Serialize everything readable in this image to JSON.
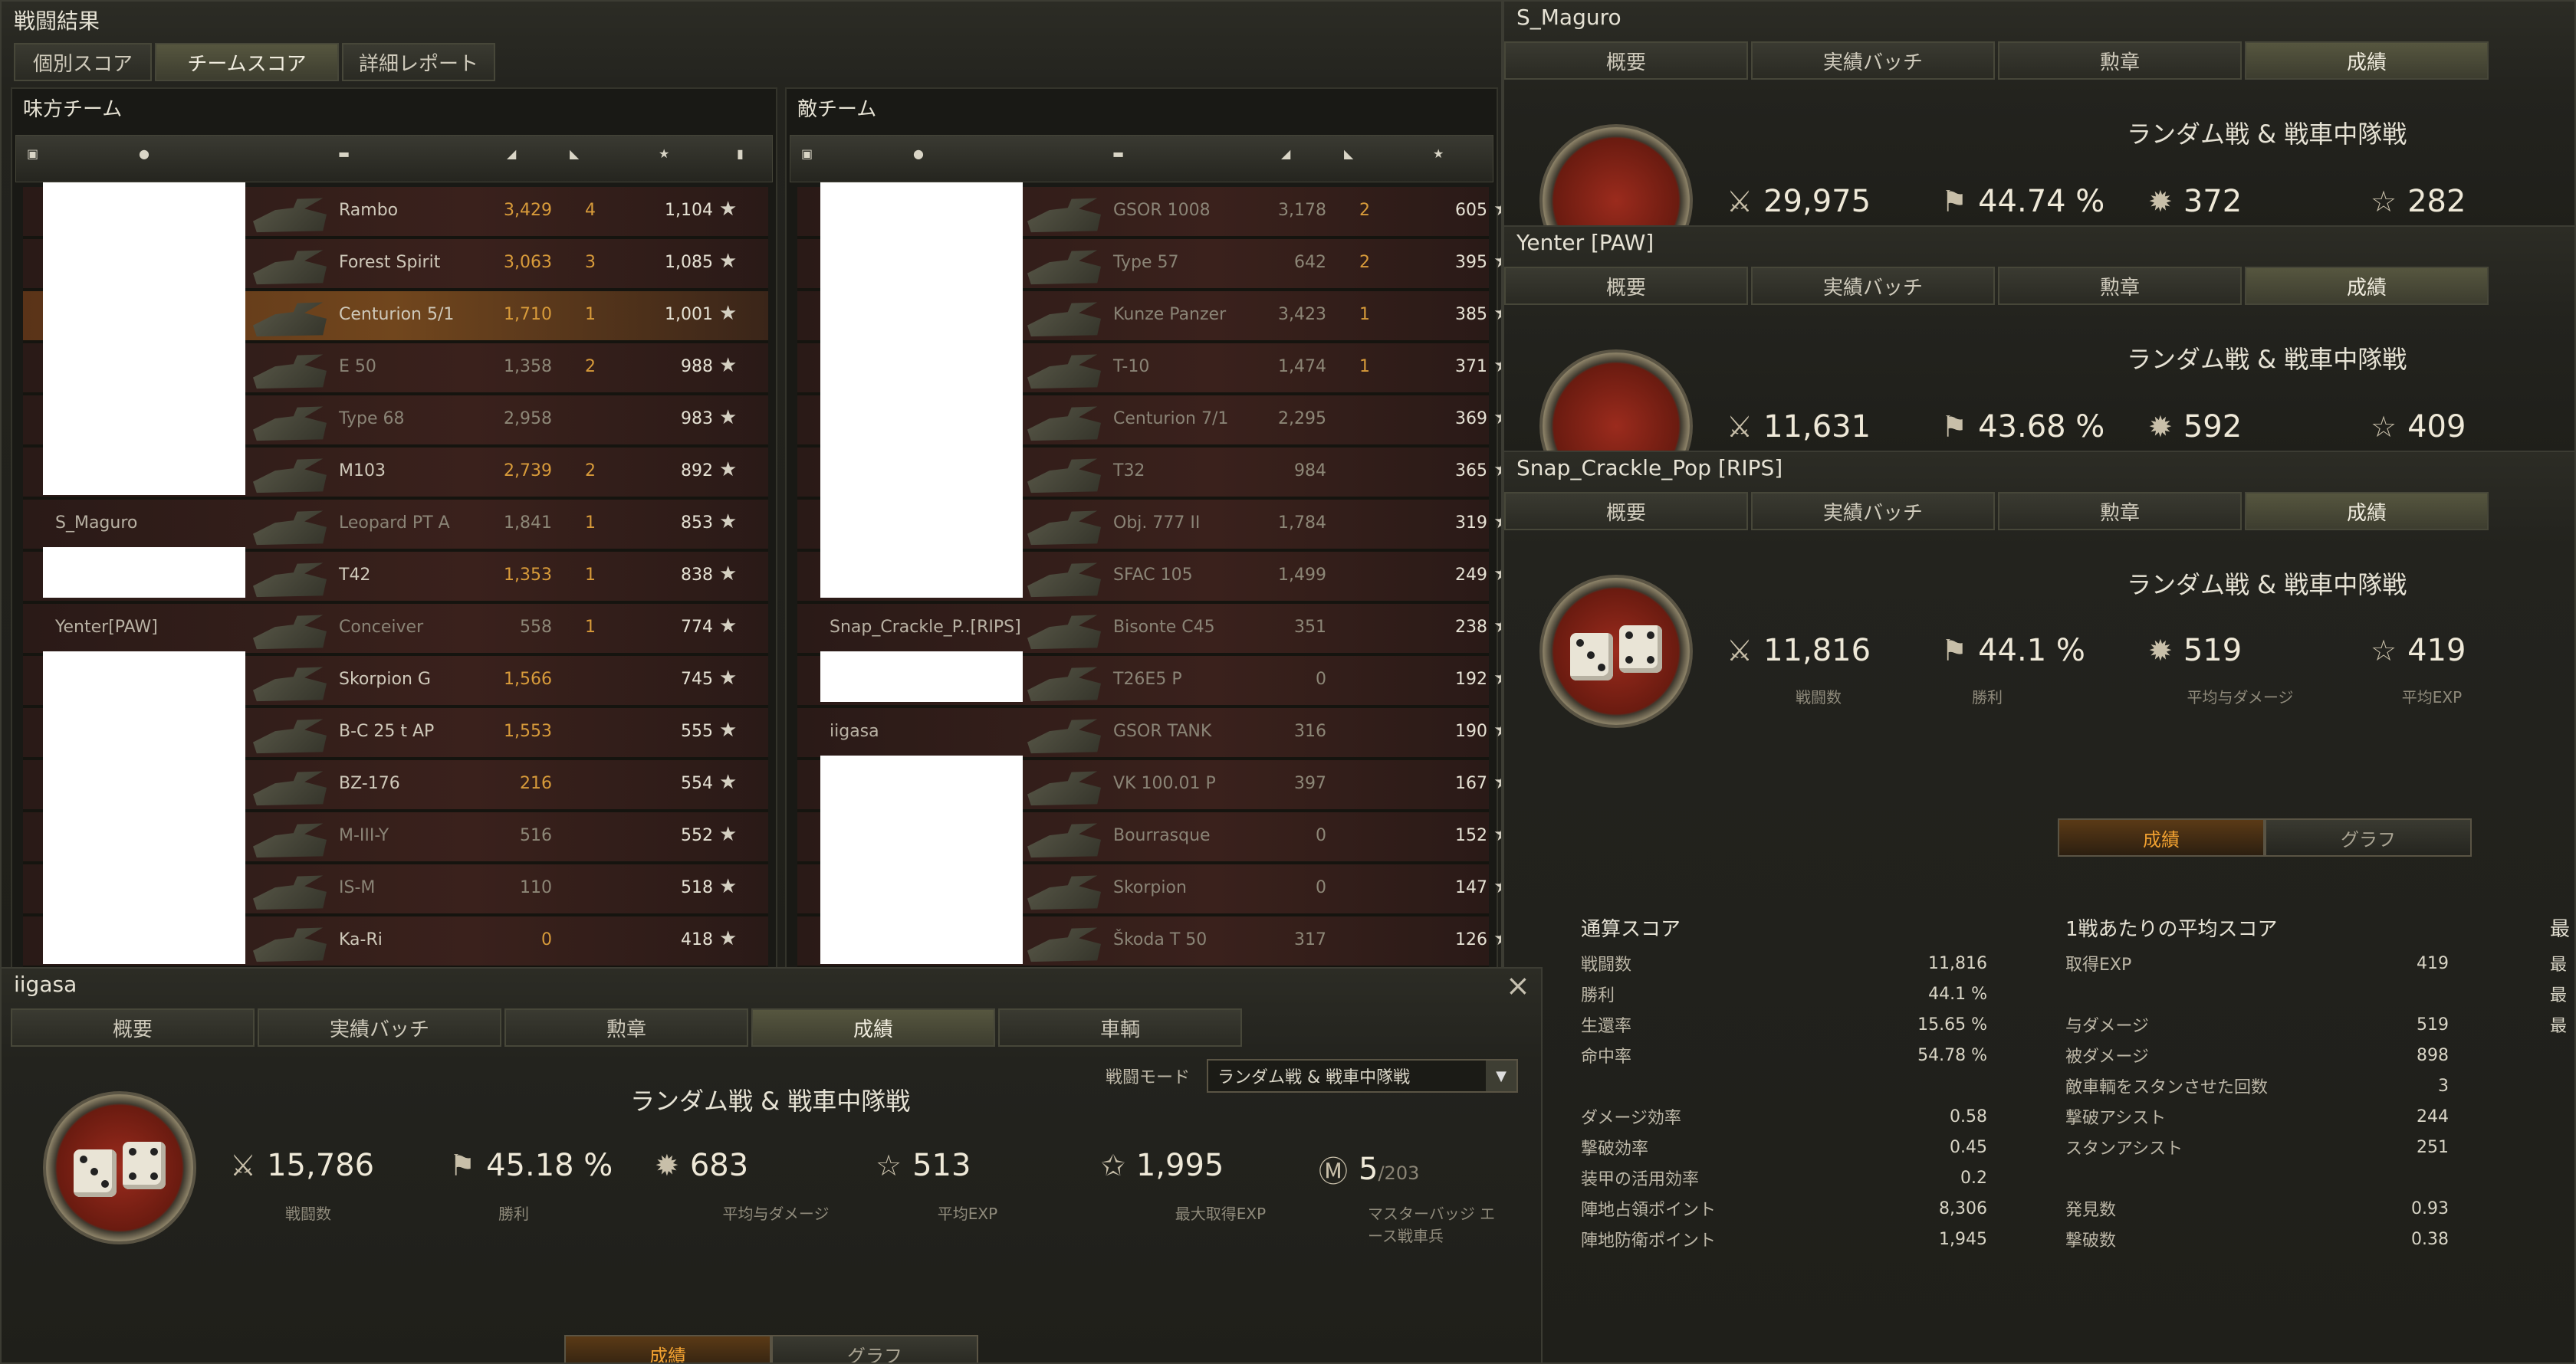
{
  "main": {
    "title": "戦闘結果",
    "tabs": [
      "個別スコア",
      "チームスコア",
      "詳細レポート"
    ]
  },
  "ally": {
    "title": "味方チーム",
    "rows": [
      {
        "player": "",
        "tank": "Rambo",
        "dmg": "3,429",
        "kills": "4",
        "exp": "1,104",
        "dead": false
      },
      {
        "player": "",
        "tank": "Forest Spirit",
        "dmg": "3,063",
        "kills": "3",
        "exp": "1,085",
        "dead": false
      },
      {
        "player": "",
        "tank": "Centurion 5/1",
        "dmg": "1,710",
        "kills": "1",
        "exp": "1,001",
        "dead": false,
        "hl": true
      },
      {
        "player": "",
        "tank": "E 50",
        "dmg": "1,358",
        "kills": "2",
        "exp": "988",
        "dead": true
      },
      {
        "player": "",
        "tank": "Type 68",
        "dmg": "2,958",
        "kills": "",
        "exp": "983",
        "dead": true
      },
      {
        "player": "",
        "tank": "M103",
        "dmg": "2,739",
        "kills": "2",
        "exp": "892",
        "dead": false
      },
      {
        "player": "S_Maguro",
        "tank": "Leopard PT A",
        "dmg": "1,841",
        "kills": "1",
        "exp": "853",
        "dead": true
      },
      {
        "player": "",
        "tank": "T42",
        "dmg": "1,353",
        "kills": "1",
        "exp": "838",
        "dead": false
      },
      {
        "player": "Yenter[PAW]",
        "tank": "Conceiver",
        "dmg": "558",
        "kills": "1",
        "exp": "774",
        "dead": true
      },
      {
        "player": "",
        "tank": "Skorpion G",
        "dmg": "1,566",
        "kills": "",
        "exp": "745",
        "dead": false
      },
      {
        "player": "",
        "tank": "B-C 25 t AP",
        "dmg": "1,553",
        "kills": "",
        "exp": "555",
        "dead": false
      },
      {
        "player": "",
        "tank": "BZ-176",
        "dmg": "216",
        "kills": "",
        "exp": "554",
        "dead": false
      },
      {
        "player": "",
        "tank": "M-III-Y",
        "dmg": "516",
        "kills": "",
        "exp": "552",
        "dead": true
      },
      {
        "player": "",
        "tank": "IS-M",
        "dmg": "110",
        "kills": "",
        "exp": "518",
        "dead": true
      },
      {
        "player": "",
        "tank": "Ka-Ri",
        "dmg": "0",
        "kills": "",
        "exp": "418",
        "dead": false
      }
    ]
  },
  "enemy": {
    "title": "敵チーム",
    "rows": [
      {
        "player": "",
        "tank": "GSOR 1008",
        "dmg": "3,178",
        "kills": "2",
        "exp": "605",
        "dead": true
      },
      {
        "player": "",
        "tank": "Type 57",
        "dmg": "642",
        "kills": "2",
        "exp": "395",
        "dead": true
      },
      {
        "player": "",
        "tank": "Kunze Panzer",
        "dmg": "3,423",
        "kills": "1",
        "exp": "385",
        "dead": true
      },
      {
        "player": "",
        "tank": "T-10",
        "dmg": "1,474",
        "kills": "1",
        "exp": "371",
        "dead": true
      },
      {
        "player": "",
        "tank": "Centurion 7/1",
        "dmg": "2,295",
        "kills": "",
        "exp": "369",
        "dead": true
      },
      {
        "player": "",
        "tank": "T32",
        "dmg": "984",
        "kills": "",
        "exp": "365",
        "dead": true
      },
      {
        "player": "",
        "tank": "Obj. 777 II",
        "dmg": "1,784",
        "kills": "",
        "exp": "319",
        "dead": true
      },
      {
        "player": "",
        "tank": "SFAC 105",
        "dmg": "1,499",
        "kills": "",
        "exp": "249",
        "dead": true
      },
      {
        "player": "Snap_Crackle_P..[RIPS]",
        "tank": "Bisonte C45",
        "dmg": "351",
        "kills": "",
        "exp": "238",
        "dead": true
      },
      {
        "player": "",
        "tank": "T26E5 P",
        "dmg": "0",
        "kills": "",
        "exp": "192",
        "dead": true
      },
      {
        "player": "iigasa",
        "tank": "GSOR TANK",
        "dmg": "316",
        "kills": "",
        "exp": "190",
        "dead": true
      },
      {
        "player": "",
        "tank": "VK 100.01 P",
        "dmg": "397",
        "kills": "",
        "exp": "167",
        "dead": true
      },
      {
        "player": "",
        "tank": "Bourrasque",
        "dmg": "0",
        "kills": "",
        "exp": "152",
        "dead": true
      },
      {
        "player": "",
        "tank": "Skorpion",
        "dmg": "0",
        "kills": "",
        "exp": "147",
        "dead": true
      },
      {
        "player": "",
        "tank": "Škoda T 50",
        "dmg": "317",
        "kills": "",
        "exp": "126",
        "dead": true
      }
    ]
  },
  "profile_tabs": [
    "概要",
    "実績バッチ",
    "勲章",
    "成績",
    "車輌"
  ],
  "mode_title": "ランダム戦 & 戦車中隊戦",
  "labels": {
    "battles": "戦闘数",
    "wins": "勝利",
    "avg_dmg": "平均与ダメージ",
    "avg_exp": "平均EXP",
    "max_exp": "最大取得EXP",
    "master": "マスターバッジ エース戦車兵"
  },
  "p1": {
    "name": "S_Maguro",
    "battles": "29,975",
    "win": "44.74 %",
    "dmg": "372",
    "exp": "282"
  },
  "p2": {
    "name": "Yenter [PAW]",
    "battles": "11,631",
    "win": "43.68 %",
    "dmg": "592",
    "exp": "409"
  },
  "p3": {
    "name": "Snap_Crackle_Pop [RIPS]",
    "battles": "11,816",
    "win": "44.1 %",
    "dmg": "519",
    "exp": "419",
    "subtabs": [
      "成績",
      "グラフ"
    ],
    "total": {
      "title": "通算スコア",
      "rows": [
        [
          "戦闘数",
          "11,816"
        ],
        [
          "勝利",
          "44.1 %"
        ],
        [
          "生還率",
          "15.65 %"
        ],
        [
          "命中率",
          "54.78 %"
        ],
        [
          "",
          ""
        ],
        [
          "ダメージ効率",
          "0.58"
        ],
        [
          "撃破効率",
          "0.45"
        ],
        [
          "装甲の活用効率",
          "0.2"
        ],
        [
          "陣地占領ポイント",
          "8,306"
        ],
        [
          "陣地防衛ポイント",
          "1,945"
        ]
      ]
    },
    "avg": {
      "title": "1戦あたりの平均スコア",
      "rows": [
        [
          "取得EXP",
          "419"
        ],
        [
          "",
          ""
        ],
        [
          "与ダメージ",
          "519"
        ],
        [
          "被ダメージ",
          "898"
        ],
        [
          "敵車輌をスタンさせた回数",
          "3"
        ],
        [
          "撃破アシスト",
          "244"
        ],
        [
          "スタンアシスト",
          "251"
        ],
        [
          "",
          ""
        ],
        [
          "発見数",
          "0.93"
        ],
        [
          "撃破数",
          "0.38"
        ]
      ]
    },
    "best": {
      "title": "最",
      "rows": [
        "最",
        "最",
        "最"
      ]
    }
  },
  "p4": {
    "name": "iigasa",
    "battles": "15,786",
    "win": "45.18 %",
    "dmg": "683",
    "exp": "513",
    "maxexp": "1,995",
    "master": "5",
    "master_total": "/203",
    "mode_label": "戦闘モード",
    "mode_value": "ランダム戦 & 戦車中隊戦",
    "subtabs": [
      "成績",
      "グラフ"
    ]
  },
  "colors": {
    "accent": "#f0a030",
    "damage": "#d89b3a"
  }
}
